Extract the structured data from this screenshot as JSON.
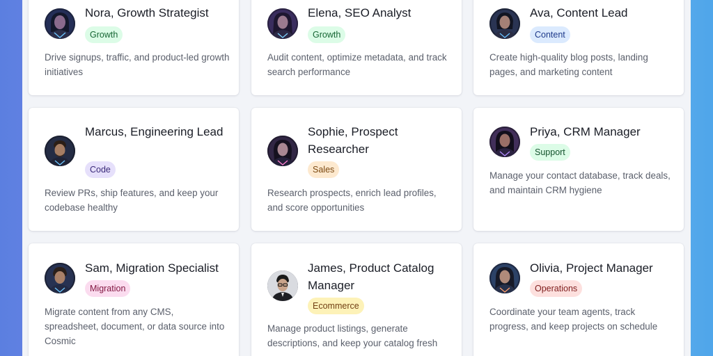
{
  "agents": [
    {
      "name": "Nora, Growth Strategist",
      "tag": "Growth",
      "tag_bg": "#dcfce7",
      "tag_fg": "#166534",
      "description": "Drive signups, traffic, and product-led growth initiatives",
      "avatar_icon": "nora-avatar-icon"
    },
    {
      "name": "Elena, SEO Analyst",
      "tag": "Growth",
      "tag_bg": "#dcfce7",
      "tag_fg": "#166534",
      "description": "Audit content, optimize metadata, and track search performance",
      "avatar_icon": "elena-avatar-icon"
    },
    {
      "name": "Ava, Content Lead",
      "tag": "Content",
      "tag_bg": "#dbeafe",
      "tag_fg": "#1e3a8a",
      "description": "Create high-quality blog posts, landing pages, and marketing content",
      "avatar_icon": "ava-avatar-icon"
    },
    {
      "name": "Marcus, Engineering Lead",
      "tag": "Code",
      "tag_bg": "#e6e0fb",
      "tag_fg": "#3b2a7a",
      "description": "Review PRs, ship features, and keep your codebase healthy",
      "avatar_icon": "marcus-avatar-icon"
    },
    {
      "name": "Sophie, Prospect Researcher",
      "tag": "Sales",
      "tag_bg": "#fde9cf",
      "tag_fg": "#7c4a12",
      "description": "Research prospects, enrich lead profiles, and score opportunities",
      "avatar_icon": "sophie-avatar-icon"
    },
    {
      "name": "Priya, CRM Manager",
      "tag": "Support",
      "tag_bg": "#dcfce7",
      "tag_fg": "#14532d",
      "description": "Manage your contact database, track deals, and maintain CRM hygiene",
      "avatar_icon": "priya-avatar-icon"
    },
    {
      "name": "Sam, Migration Specialist",
      "tag": "Migration",
      "tag_bg": "#fbdcef",
      "tag_fg": "#831843",
      "description": "Migrate content from any CMS, spreadsheet, document, or data source into Cosmic",
      "avatar_icon": "sam-avatar-icon"
    },
    {
      "name": "James, Product Catalog Manager",
      "tag": "Ecommerce",
      "tag_bg": "#fdf2b8",
      "tag_fg": "#713f12",
      "description": "Manage product listings, generate descriptions, and keep your catalog fresh",
      "avatar_icon": "james-avatar-icon"
    },
    {
      "name": "Olivia, Project Manager",
      "tag": "Operations",
      "tag_bg": "#fde0de",
      "tag_fg": "#7f1d1d",
      "description": "Coordinate your team agents, track progress, and keep projects on schedule",
      "avatar_icon": "olivia-avatar-icon"
    }
  ]
}
